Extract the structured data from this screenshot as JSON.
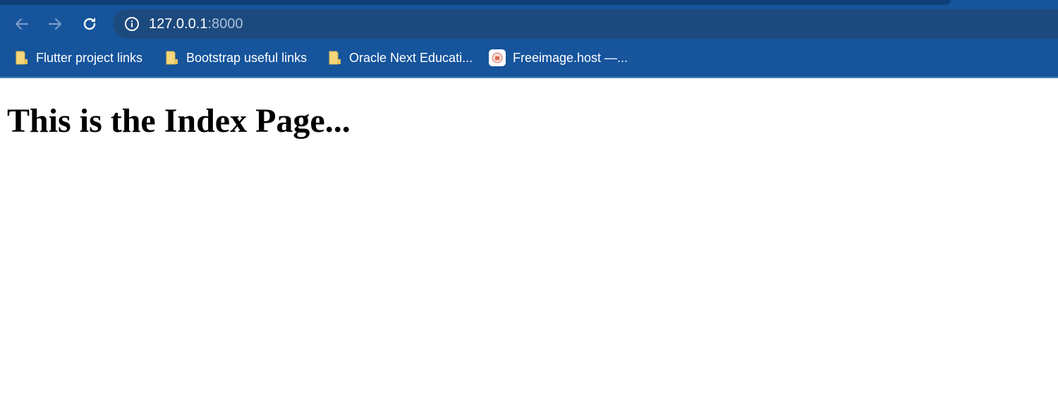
{
  "browser": {
    "address_bar": {
      "host": "127.0.0.1",
      "port": ":8000"
    },
    "bookmarks": [
      {
        "label": "Flutter project links",
        "icon": "folder-icon"
      },
      {
        "label": "Bootstrap useful links",
        "icon": "folder-icon"
      },
      {
        "label": "Oracle Next Educati...",
        "icon": "folder-icon"
      },
      {
        "label": "Freeimage.host —...",
        "icon": "freeimage-site-icon"
      }
    ],
    "colors": {
      "chrome": "#16549c",
      "omnibox": "#1d4a7e",
      "folder": "#f5d77c"
    }
  },
  "page": {
    "heading": "This is the Index Page..."
  }
}
